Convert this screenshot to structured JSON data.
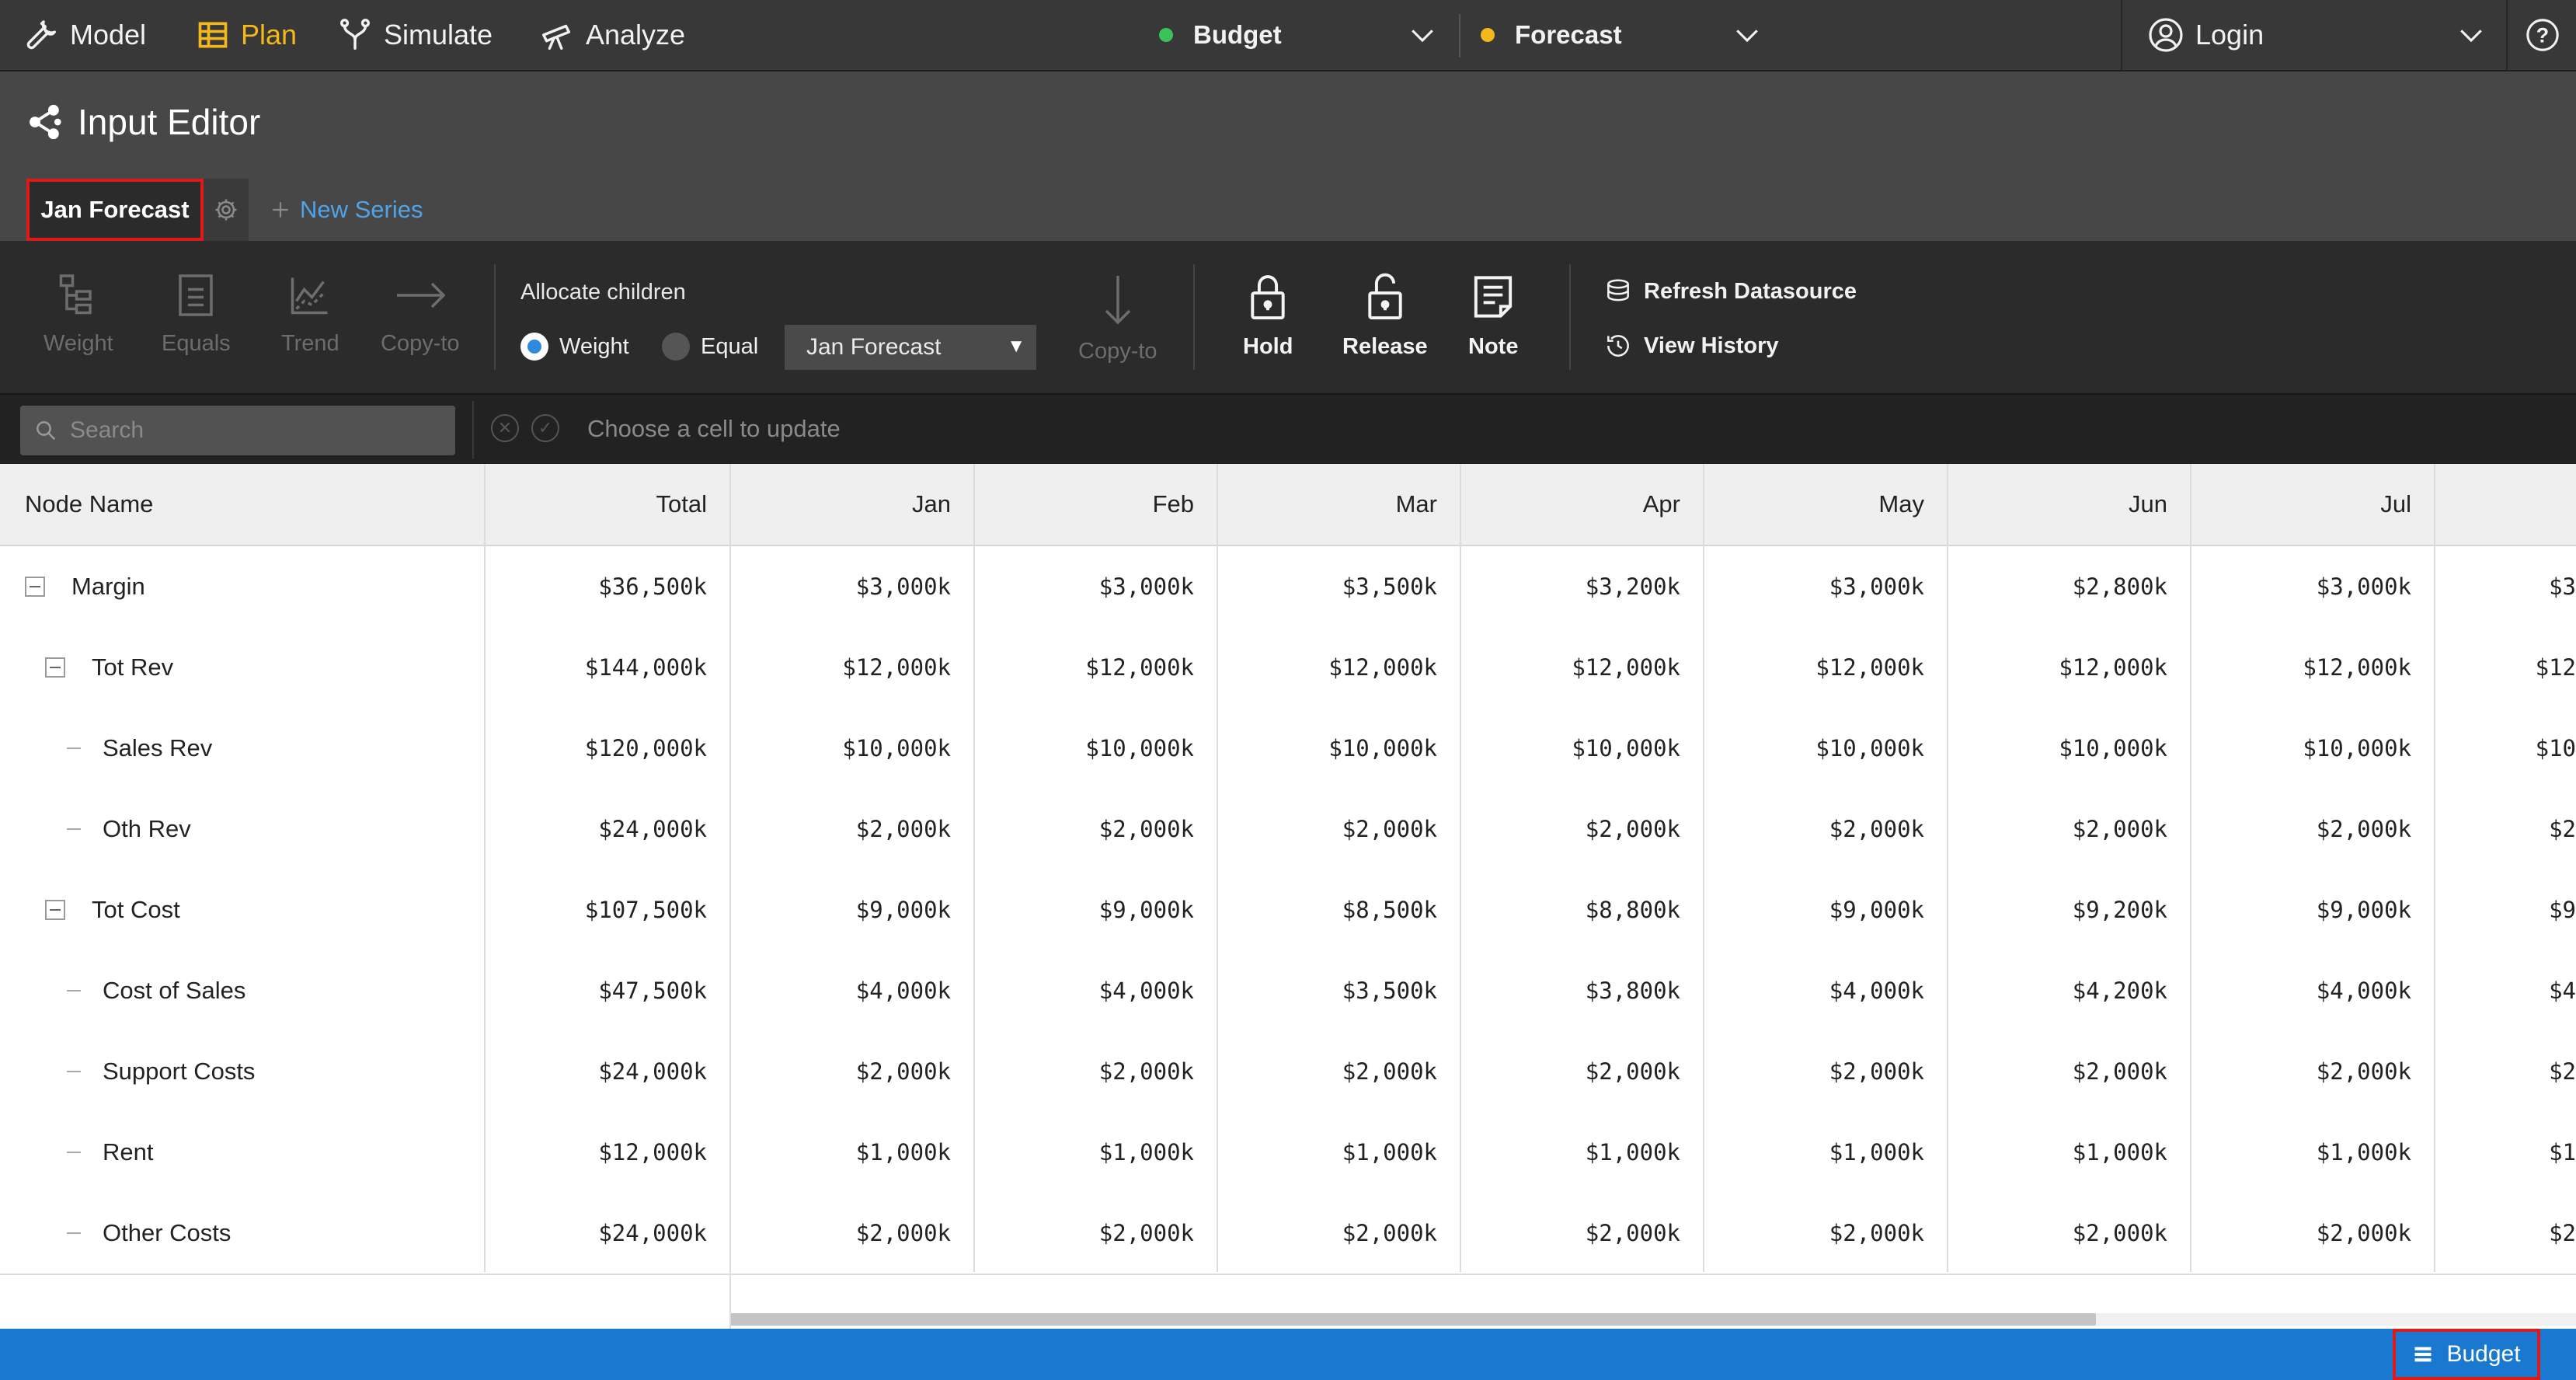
{
  "nav": {
    "model": "Model",
    "plan": "Plan",
    "simulate": "Simulate",
    "analyze": "Analyze"
  },
  "scenarios": {
    "budget": {
      "label": "Budget",
      "color": "#3cc25a"
    },
    "forecast": {
      "label": "Forecast",
      "color": "#f5b81c"
    }
  },
  "user": {
    "login": "Login",
    "help": "?"
  },
  "page": {
    "title": "Input Editor"
  },
  "tabs": {
    "active": "Jan Forecast",
    "new_series": "New Series"
  },
  "toolbar": {
    "weight": "Weight",
    "equals": "Equals",
    "trend": "Trend",
    "copy_to": "Copy-to",
    "allocate_label": "Allocate children",
    "radio_weight": "Weight",
    "radio_equal": "Equal",
    "allocate_series": "Jan Forecast",
    "copy_to_2": "Copy-to",
    "hold": "Hold",
    "release": "Release",
    "note": "Note",
    "refresh": "Refresh Datasource",
    "history": "View History"
  },
  "search": {
    "placeholder": "Search",
    "cell_hint": "Choose a cell to update"
  },
  "grid": {
    "headers": [
      "Node Name",
      "Total",
      "Jan",
      "Feb",
      "Mar",
      "Apr",
      "May",
      "Jun",
      "Jul"
    ],
    "rows": [
      {
        "name": "Margin",
        "level": 0,
        "values": [
          "$36,500k",
          "$3,000k",
          "$3,000k",
          "$3,500k",
          "$3,200k",
          "$3,000k",
          "$2,800k",
          "$3,000k"
        ],
        "cut": "$3"
      },
      {
        "name": "Tot Rev",
        "level": 1,
        "values": [
          "$144,000k",
          "$12,000k",
          "$12,000k",
          "$12,000k",
          "$12,000k",
          "$12,000k",
          "$12,000k",
          "$12,000k"
        ],
        "cut": "$12"
      },
      {
        "name": "Sales Rev",
        "level": 2,
        "values": [
          "$120,000k",
          "$10,000k",
          "$10,000k",
          "$10,000k",
          "$10,000k",
          "$10,000k",
          "$10,000k",
          "$10,000k"
        ],
        "cut": "$10"
      },
      {
        "name": "Oth Rev",
        "level": 2,
        "values": [
          "$24,000k",
          "$2,000k",
          "$2,000k",
          "$2,000k",
          "$2,000k",
          "$2,000k",
          "$2,000k",
          "$2,000k"
        ],
        "cut": "$2"
      },
      {
        "name": "Tot Cost",
        "level": 1,
        "values": [
          "$107,500k",
          "$9,000k",
          "$9,000k",
          "$8,500k",
          "$8,800k",
          "$9,000k",
          "$9,200k",
          "$9,000k"
        ],
        "cut": "$9"
      },
      {
        "name": "Cost of Sales",
        "level": 2,
        "values": [
          "$47,500k",
          "$4,000k",
          "$4,000k",
          "$3,500k",
          "$3,800k",
          "$4,000k",
          "$4,200k",
          "$4,000k"
        ],
        "cut": "$4"
      },
      {
        "name": "Support Costs",
        "level": 2,
        "values": [
          "$24,000k",
          "$2,000k",
          "$2,000k",
          "$2,000k",
          "$2,000k",
          "$2,000k",
          "$2,000k",
          "$2,000k"
        ],
        "cut": "$2"
      },
      {
        "name": "Rent",
        "level": 2,
        "values": [
          "$12,000k",
          "$1,000k",
          "$1,000k",
          "$1,000k",
          "$1,000k",
          "$1,000k",
          "$1,000k",
          "$1,000k"
        ],
        "cut": "$1"
      },
      {
        "name": "Other Costs",
        "level": 2,
        "values": [
          "$24,000k",
          "$2,000k",
          "$2,000k",
          "$2,000k",
          "$2,000k",
          "$2,000k",
          "$2,000k",
          "$2,000k"
        ],
        "cut": "$2"
      }
    ]
  },
  "status": {
    "scenario_button": "Budget"
  }
}
